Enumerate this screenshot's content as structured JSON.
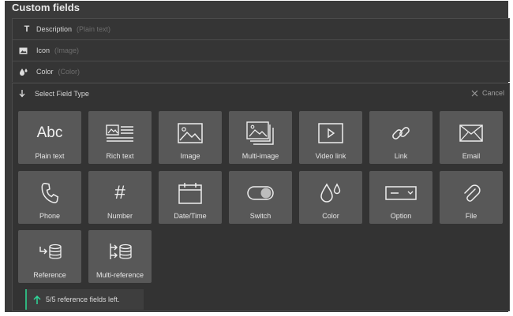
{
  "panel": {
    "title": "Custom fields"
  },
  "fields": [
    {
      "icon": "text-icon",
      "name": "Description",
      "type": "(Plain text)"
    },
    {
      "icon": "image-icon",
      "name": "Icon",
      "type": "(Image)"
    },
    {
      "icon": "color-drops-icon",
      "name": "Color",
      "type": "(Color)"
    }
  ],
  "selector": {
    "title": "Select Field Type",
    "cancel_label": "Cancel"
  },
  "field_types": [
    {
      "label": "Plain text",
      "icon": "abc-icon",
      "glyph": "Abc"
    },
    {
      "label": "Rich text",
      "icon": "rich-text-icon"
    },
    {
      "label": "Image",
      "icon": "image-icon"
    },
    {
      "label": "Multi-image",
      "icon": "multi-image-icon"
    },
    {
      "label": "Video link",
      "icon": "video-link-icon"
    },
    {
      "label": "Link",
      "icon": "link-icon"
    },
    {
      "label": "Email",
      "icon": "email-icon"
    },
    {
      "label": "Phone",
      "icon": "phone-icon"
    },
    {
      "label": "Number",
      "icon": "hash-icon",
      "glyph": "#"
    },
    {
      "label": "Date/Time",
      "icon": "calendar-icon"
    },
    {
      "label": "Switch",
      "icon": "switch-icon"
    },
    {
      "label": "Color",
      "icon": "color-drops-icon"
    },
    {
      "label": "Option",
      "icon": "option-dropdown-icon"
    },
    {
      "label": "File",
      "icon": "paperclip-icon"
    },
    {
      "label": "Reference",
      "icon": "reference-icon"
    },
    {
      "label": "Multi-reference",
      "icon": "multi-reference-icon"
    }
  ],
  "notice": {
    "text": "5/5 reference fields left.",
    "accent": "#2fb37e"
  }
}
